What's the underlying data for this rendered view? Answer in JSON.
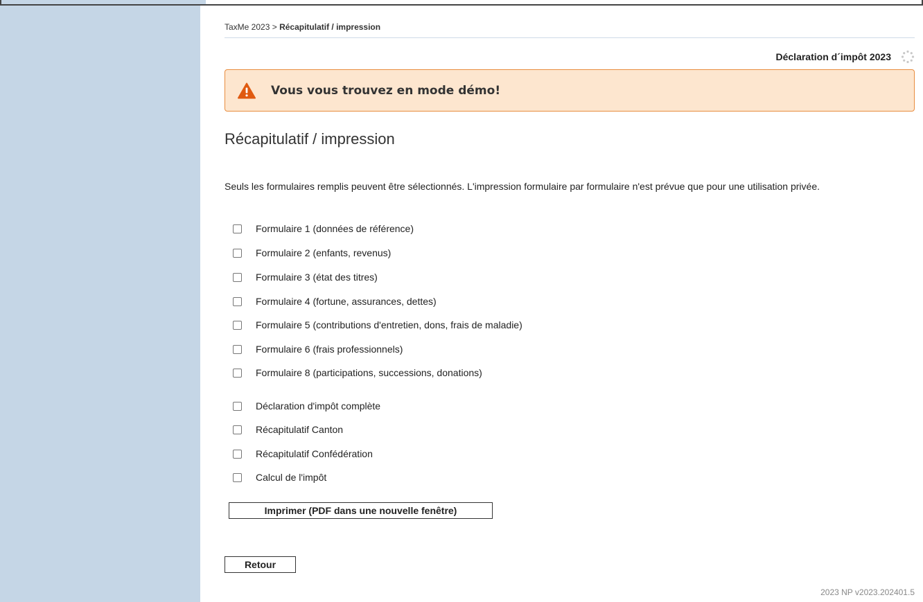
{
  "breadcrumb": {
    "root": "TaxMe 2023",
    "separator": " > ",
    "current": "Récapitulatif / impression"
  },
  "header": {
    "declaration_title": "Déclaration d´impôt 2023",
    "spinner_icon": "loading-spinner-icon"
  },
  "alert": {
    "icon": "warning-icon",
    "text": "Vous vous trouvez en mode démo!",
    "color": "#e88c3e"
  },
  "page": {
    "title": "Récapitulatif / impression",
    "intro": "Seuls les formulaires remplis peuvent être sélectionnés. L'impression formulaire par formulaire n'est prévue que pour une utilisation privée."
  },
  "forms": [
    {
      "label": "Formulaire 1 (données de référence)",
      "checked": false
    },
    {
      "label": "Formulaire 2 (enfants, revenus)",
      "checked": false
    },
    {
      "label": "Formulaire 3 (état des titres)",
      "checked": false
    },
    {
      "label": "Formulaire 4 (fortune, assurances, dettes)",
      "checked": false
    },
    {
      "label": "Formulaire 5 (contributions d'entretien, dons, frais de maladie)",
      "checked": false
    },
    {
      "label": "Formulaire 6 (frais professionnels)",
      "checked": false
    },
    {
      "label": "Formulaire 8 (participations, successions, donations)",
      "checked": false
    }
  ],
  "summaries": [
    {
      "label": "Déclaration d'impôt complète",
      "checked": false
    },
    {
      "label": "Récapitulatif Canton",
      "checked": false
    },
    {
      "label": "Récapitulatif Confédération",
      "checked": false
    },
    {
      "label": "Calcul de l'impôt",
      "checked": false
    }
  ],
  "buttons": {
    "print": "Imprimer (PDF dans une nouvelle fenêtre)",
    "back": "Retour"
  },
  "footer": {
    "version": "2023 NP v2023.202401.5"
  },
  "colors": {
    "sidebar": "#c5d6e6",
    "alert_bg": "#fde6cf",
    "alert_border": "#e88c3e",
    "warning_icon": "#e05a10"
  }
}
